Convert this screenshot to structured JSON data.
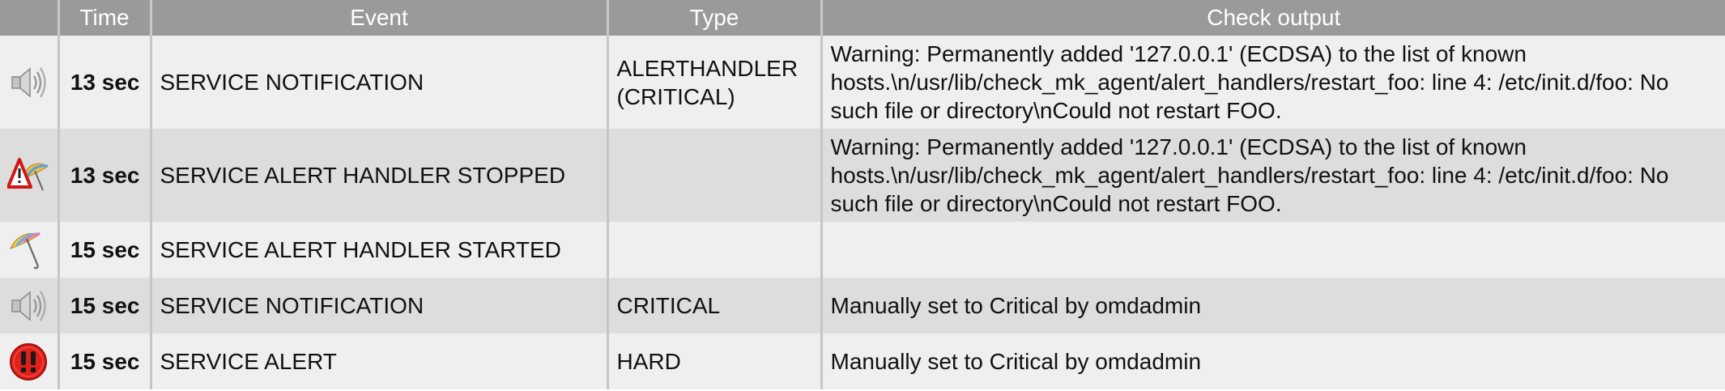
{
  "headers": {
    "icon": "",
    "time": "Time",
    "event": "Event",
    "type": "Type",
    "output": "Check output"
  },
  "rows": [
    {
      "icon": "speaker-icon",
      "time": "13 sec",
      "event": "SERVICE NOTIFICATION",
      "type_line1": "ALERTHANDLER",
      "type_line2": "(CRITICAL)",
      "output": "Warning: Permanently added '127.0.0.1' (ECDSA) to the list of known hosts.\\n/usr/lib/check_mk_agent/alert_handlers/restart_foo: line 4: /etc/init.d/foo: No such file or directory\\nCould not restart FOO."
    },
    {
      "icon": "umbrella-warning-icon",
      "time": "13 sec",
      "event": "SERVICE ALERT HANDLER STOPPED",
      "type_line1": "",
      "type_line2": "",
      "output": "Warning: Permanently added '127.0.0.1' (ECDSA) to the list of known hosts.\\n/usr/lib/check_mk_agent/alert_handlers/restart_foo: line 4: /etc/init.d/foo: No such file or directory\\nCould not restart FOO."
    },
    {
      "icon": "umbrella-icon",
      "time": "15 sec",
      "event": "SERVICE ALERT HANDLER STARTED",
      "type_line1": "",
      "type_line2": "",
      "output": ""
    },
    {
      "icon": "speaker-icon",
      "time": "15 sec",
      "event": "SERVICE NOTIFICATION",
      "type_line1": "CRITICAL",
      "type_line2": "",
      "output": "Manually set to Critical by omdadmin"
    },
    {
      "icon": "critical-alert-icon",
      "time": "15 sec",
      "event": "SERVICE ALERT",
      "type_line1": "HARD",
      "type_line2": "",
      "output": "Manually set to Critical by omdadmin"
    }
  ],
  "colors": {
    "header_bg": "#9a9a9a",
    "row_odd": "#efefef",
    "row_even": "#dddddd",
    "critical": "#e0201a"
  }
}
